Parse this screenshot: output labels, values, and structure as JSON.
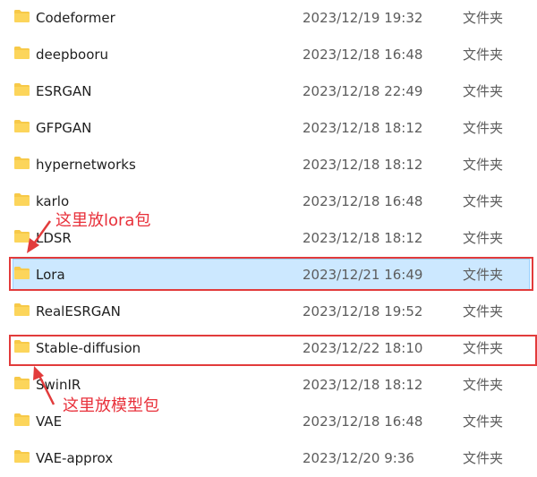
{
  "files": [
    {
      "name": "Codeformer",
      "date": "2023/12/19 19:32",
      "type": "文件夹",
      "icon": "folder-icon"
    },
    {
      "name": "deepbooru",
      "date": "2023/12/18 16:48",
      "type": "文件夹",
      "icon": "folder-icon"
    },
    {
      "name": "ESRGAN",
      "date": "2023/12/18 22:49",
      "type": "文件夹",
      "icon": "folder-icon"
    },
    {
      "name": "GFPGAN",
      "date": "2023/12/18 18:12",
      "type": "文件夹",
      "icon": "folder-icon"
    },
    {
      "name": "hypernetworks",
      "date": "2023/12/18 18:12",
      "type": "文件夹",
      "icon": "folder-icon"
    },
    {
      "name": "karlo",
      "date": "2023/12/18 16:48",
      "type": "文件夹",
      "icon": "folder-icon"
    },
    {
      "name": "LDSR",
      "date": "2023/12/18 18:12",
      "type": "文件夹",
      "icon": "folder-icon"
    },
    {
      "name": "Lora",
      "date": "2023/12/21 16:49",
      "type": "文件夹",
      "icon": "folder-icon",
      "selected": true
    },
    {
      "name": "RealESRGAN",
      "date": "2023/12/18 19:52",
      "type": "文件夹",
      "icon": "folder-icon"
    },
    {
      "name": "Stable-diffusion",
      "date": "2023/12/22 18:10",
      "type": "文件夹",
      "icon": "folder-icon"
    },
    {
      "name": "SwinIR",
      "date": "2023/12/18 18:12",
      "type": "文件夹",
      "icon": "folder-icon"
    },
    {
      "name": "VAE",
      "date": "2023/12/18 16:48",
      "type": "文件夹",
      "icon": "folder-icon"
    },
    {
      "name": "VAE-approx",
      "date": "2023/12/20 9:36",
      "type": "文件夹",
      "icon": "folder-icon"
    }
  ],
  "annotations": {
    "lora_note": "这里放lora包",
    "model_note": "这里放模型包"
  },
  "colors": {
    "folder": "#f7c948",
    "annotation_red": "#e23b3b",
    "selection_bg": "#cce8ff",
    "selection_border": "#99d1ff"
  }
}
